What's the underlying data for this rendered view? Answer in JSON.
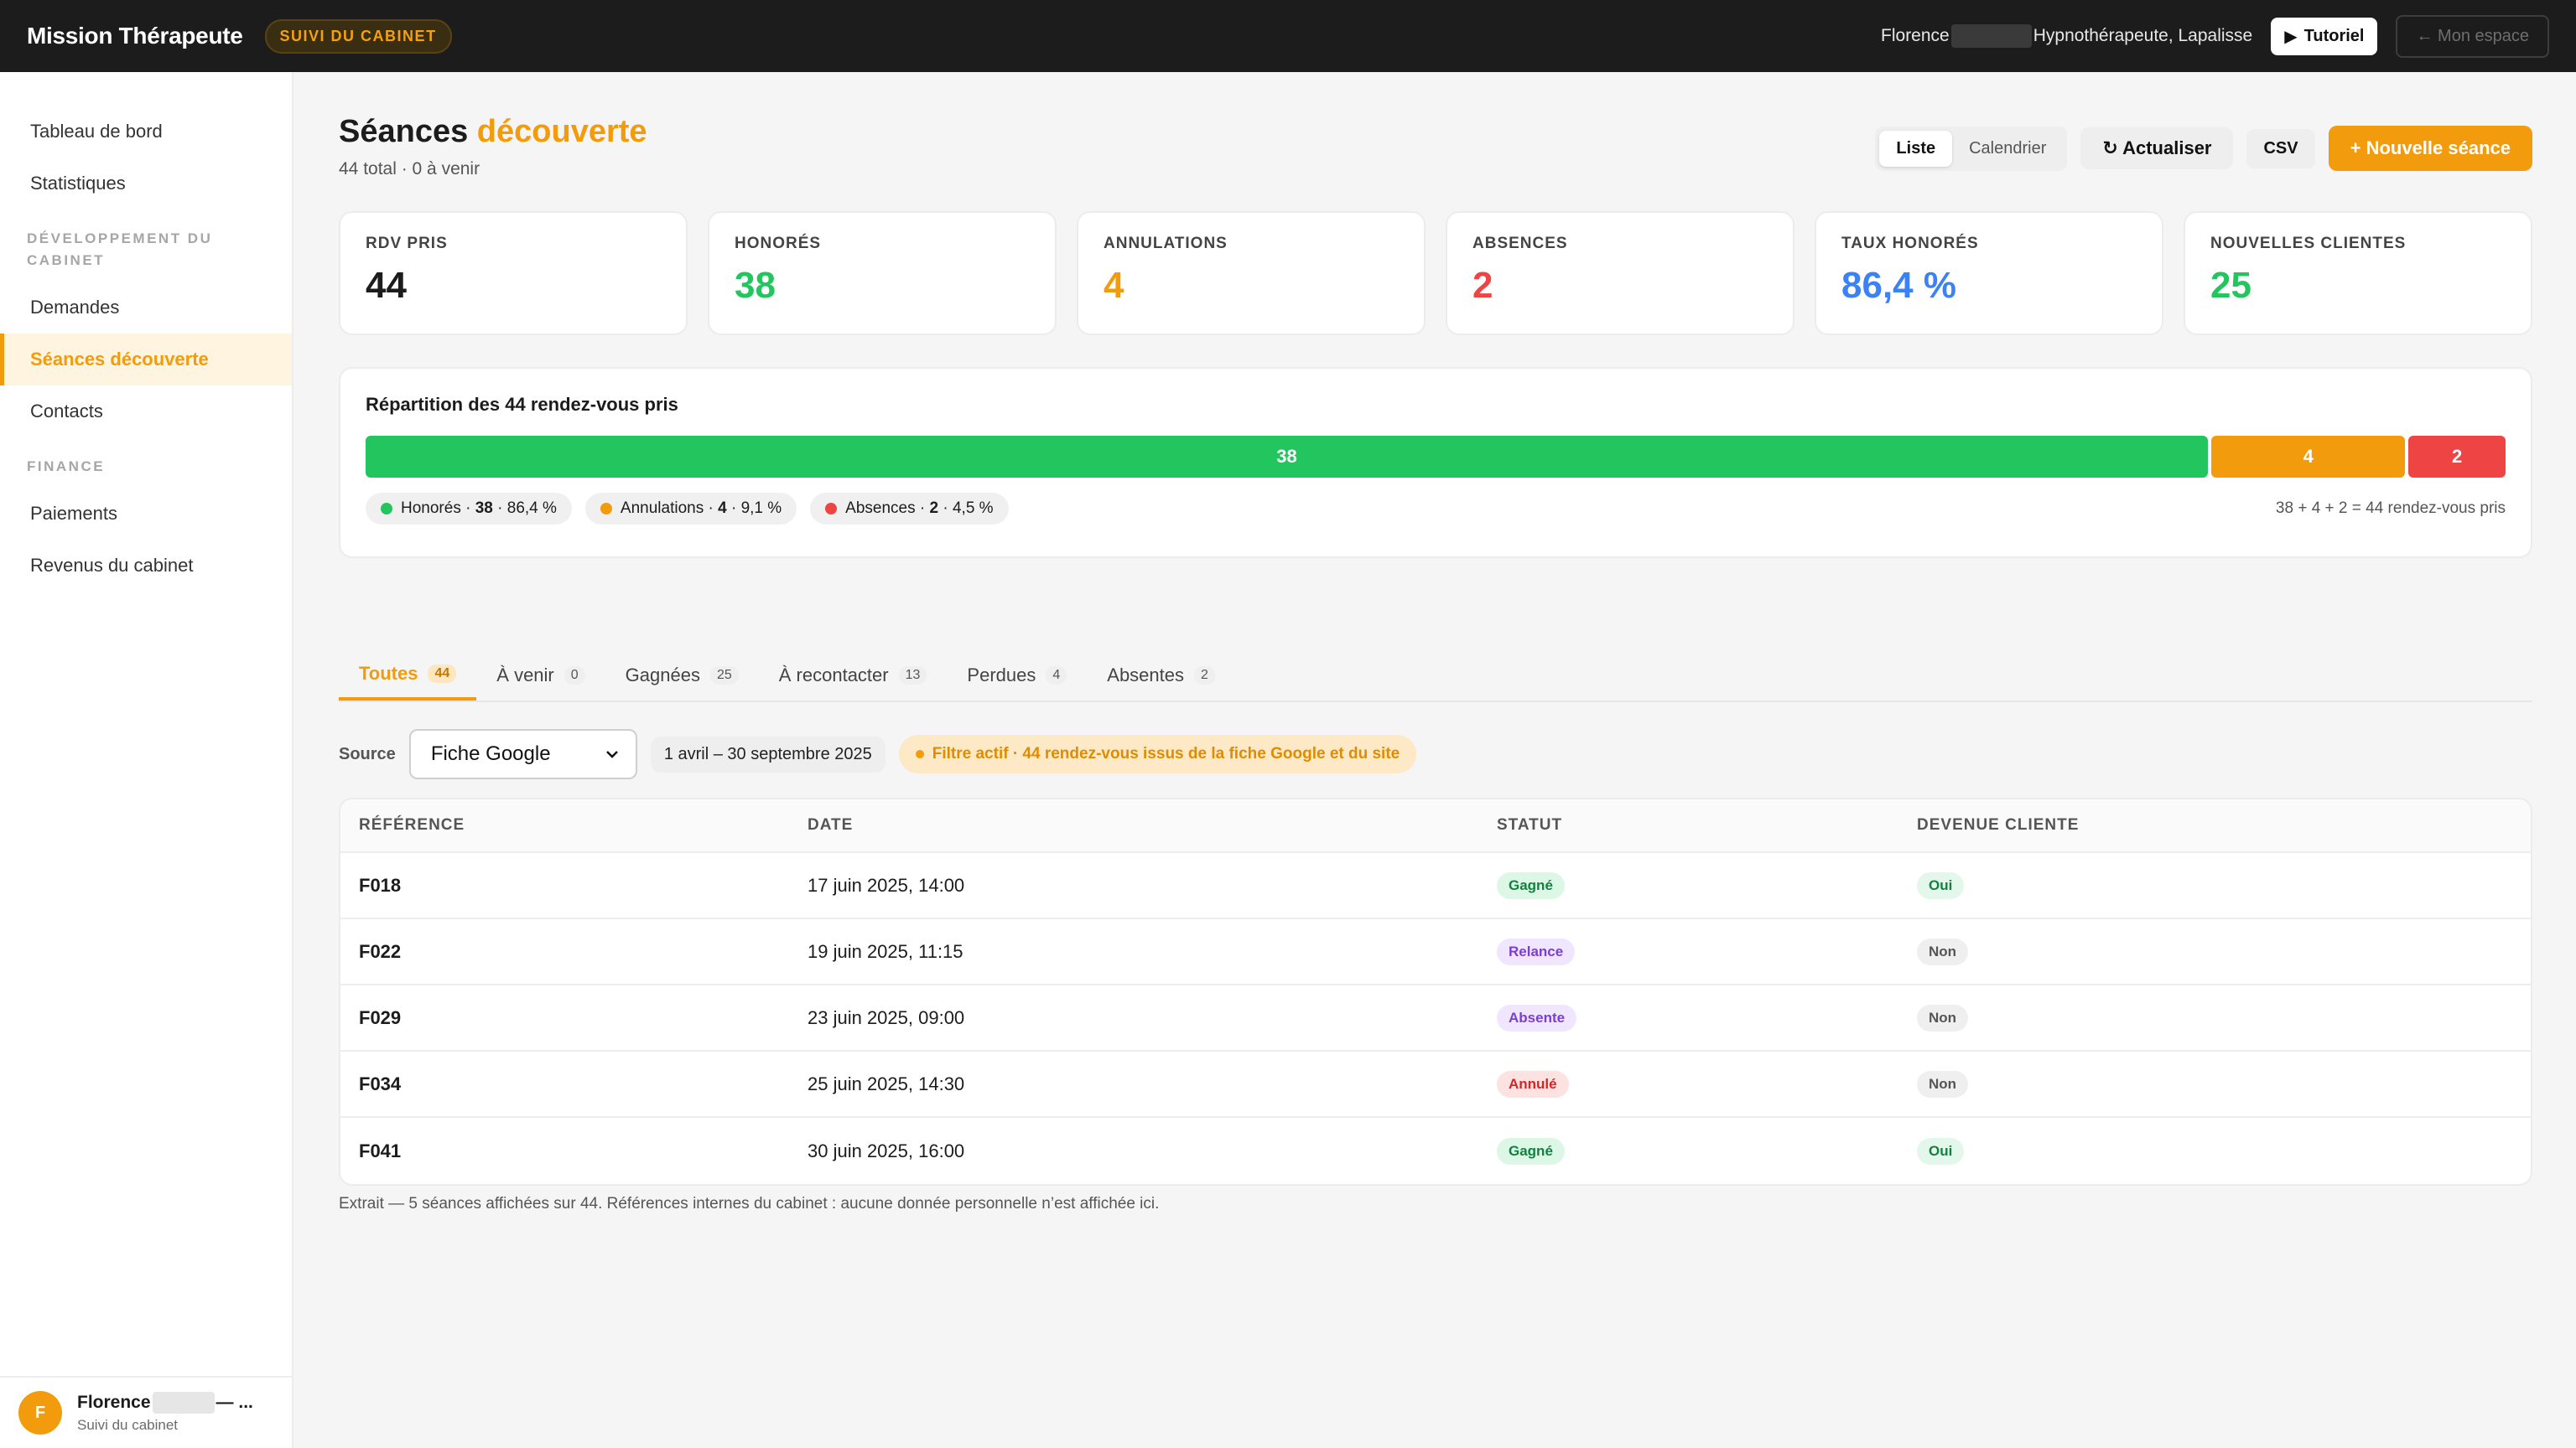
{
  "topbar": {
    "brand": "Mission Thérapeute",
    "badge": "SUIVI DU CABINET",
    "user_first": "Florence",
    "user_role": "Hypnothérapeute, Lapalisse",
    "tutorial": "Tutoriel",
    "espace": "← Mon espace"
  },
  "sidebar": {
    "item_dashboard": "Tableau de bord",
    "item_stats": "Statistiques",
    "section_dev": "DÉVELOPPEMENT DU CABINET",
    "item_demandes": "Demandes",
    "item_seances": "Séances découverte",
    "item_contacts": "Contacts",
    "section_finance": "FINANCE",
    "item_paiements": "Paiements",
    "item_revenus": "Revenus du cabinet",
    "footer": {
      "initial": "F",
      "name": "Florence",
      "name_suffix": "— ...",
      "sub": "Suivi du cabinet"
    }
  },
  "header": {
    "title_main": "Séances",
    "title_accent": "découverte",
    "subtitle": "44 total · 0 à venir",
    "view_list": "Liste",
    "view_calendar": "Calendrier",
    "refresh": "↻ Actualiser",
    "csv": "CSV",
    "new_session": "+ Nouvelle séance"
  },
  "kpis": [
    {
      "label": "RDV PRIS",
      "value": "44",
      "color": "#1c1c1c"
    },
    {
      "label": "HONORÉS",
      "value": "38",
      "color": "#22c55e"
    },
    {
      "label": "ANNULATIONS",
      "value": "4",
      "color": "#f29b0c"
    },
    {
      "label": "ABSENCES",
      "value": "2",
      "color": "#ef4444"
    },
    {
      "label": "TAUX HONORÉS",
      "value": "86,4 %",
      "color": "#3b82f6"
    },
    {
      "label": "NOUVELLES CLIENTES",
      "value": "25",
      "color": "#22c55e"
    }
  ],
  "repartition": {
    "title": "Répartition des 44 rendez-vous pris",
    "total": 44,
    "segments": [
      {
        "label": "38",
        "value": 38,
        "color": "#22c55e"
      },
      {
        "label": "4",
        "value": 4,
        "color": "#f29b0c"
      },
      {
        "label": "2",
        "value": 2,
        "color": "#ef4444"
      }
    ],
    "legend": [
      {
        "name": "Honorés",
        "count": "38",
        "pct": "86,4 %",
        "color": "#22c55e"
      },
      {
        "name": "Annulations",
        "count": "4",
        "pct": "9,1 %",
        "color": "#f29b0c"
      },
      {
        "name": "Absences",
        "count": "2",
        "pct": "4,5 %",
        "color": "#ef4444"
      }
    ],
    "sum": "38 + 4 + 2 = 44 rendez-vous pris"
  },
  "tabs": [
    {
      "label": "Toutes",
      "count": "44"
    },
    {
      "label": "À venir",
      "count": "0"
    },
    {
      "label": "Gagnées",
      "count": "25"
    },
    {
      "label": "À recontacter",
      "count": "13"
    },
    {
      "label": "Perdues",
      "count": "4"
    },
    {
      "label": "Absentes",
      "count": "2"
    }
  ],
  "filters": {
    "source_label": "Source",
    "source_value": "Fiche Google",
    "date_range": "1 avril – 30 septembre 2025",
    "active_filter": "Filtre actif · 44 rendez-vous issus de la fiche Google et du site"
  },
  "table": {
    "headers": [
      "RÉFÉRENCE",
      "DATE",
      "STATUT",
      "DEVENUE CLIENTE"
    ],
    "rows": [
      {
        "ref": "F018",
        "date": "17 juin 2025, 14:00",
        "status": "Gagné",
        "client": "Oui"
      },
      {
        "ref": "F022",
        "date": "19 juin 2025, 11:15",
        "status": "Relance",
        "client": "Non"
      },
      {
        "ref": "F029",
        "date": "23 juin 2025, 09:00",
        "status": "Absente",
        "client": "Non"
      },
      {
        "ref": "F034",
        "date": "25 juin 2025, 14:30",
        "status": "Annulé",
        "client": "Non"
      },
      {
        "ref": "F041",
        "date": "30 juin 2025, 16:00",
        "status": "Gagné",
        "client": "Oui"
      }
    ]
  },
  "footnote": "Extrait — 5 séances affichées sur 44. Références internes du cabinet : aucune donnée personnelle n’est affichée ici."
}
